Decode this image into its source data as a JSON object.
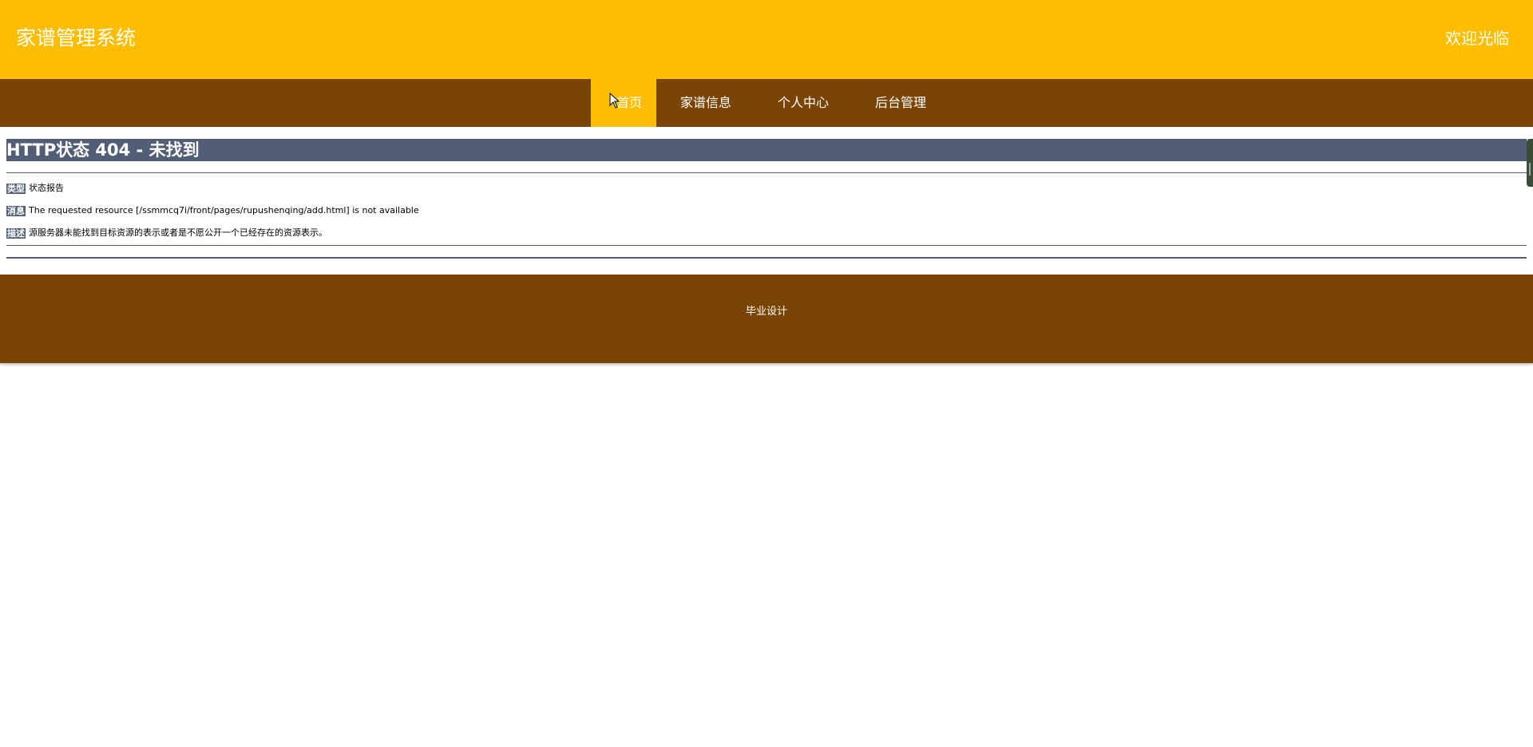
{
  "header": {
    "site_title": "家谱管理系统",
    "welcome": "欢迎光临",
    "background_color": "#fdbd00"
  },
  "nav": {
    "background_color": "#7a4405",
    "items": [
      {
        "label": "首页",
        "active": true
      },
      {
        "label": "家谱信息",
        "active": false
      },
      {
        "label": "个人中心",
        "active": false
      },
      {
        "label": "后台管理",
        "active": false
      }
    ]
  },
  "error": {
    "title": "HTTP状态 404 - 未找到",
    "type_tag": "类型",
    "type_value": "状态报告",
    "message_tag": "消息",
    "message_value": "The requested resource [/ssmmcq7i/front/pages/rupushenqing/add.html] is not available",
    "description_tag": "描述",
    "description_value": "源服务器未能找到目标资源的表示或者是不愿公开一个已经存在的资源表示。",
    "accent_color": "#525d76"
  },
  "footer": {
    "text": "毕业设计"
  },
  "icons": {
    "cursor": "mouse-pointer-icon",
    "scroll_handle": "scroll-handle-icon"
  }
}
